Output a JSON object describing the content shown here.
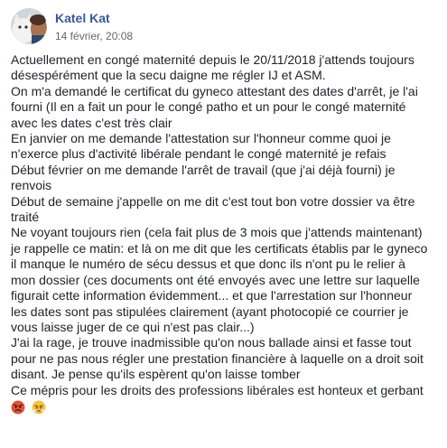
{
  "post": {
    "author": "Katel Kat",
    "timestamp": "14 février, 20:08",
    "lines": [
      "Actuellement en congé maternité depuis le 20/11/2018 j'attends toujours",
      "désespérément que la secu daigne me régler IJ et ASM.",
      "On m'a demandé le certificat du gyneco attestant des dates d'arrêt, je l'ai",
      "fourni (Il en a fait un pour le congé patho et un pour le congé maternité",
      "avec les dates c'est très clair",
      "En janvier on me demande l'attestation sur l'honneur comme quoi je",
      "n'exerce plus d'activité libérale pendant le congé maternité je refais",
      "Début février on me demande l'arrêt de travail (que j'ai déjà fourni) je",
      "renvois",
      "Début de semaine j'appelle on me dit c'est tout bon votre dossier va être",
      "traité",
      "Ne voyant toujours rien (cela fait plus de 3 mois que j'attends maintenant)",
      "je rappelle ce matin: et là on me dit que les certificats établis par le gyneco",
      "il manque le numéro de sécu dessus et que donc ils n'ont pu le relier à",
      "mon dossier (ces documents ont été envoyés avec une lettre sur laquelle",
      "figurait cette information évidemment... et que l'arrestation sur l'honneur",
      "les dates sont pas stipulées clairement (ayant photocopié ce courrier je",
      "vous laisse juger de ce qui n'est pas clair...)",
      "J'ai la rage, je trouve inadmissible qu'on nous ballade ainsi et fasse tout",
      "pour ne pas nous régler une prestation financière à laquelle on a droit soit",
      "disant. Je pense qu'ils espèrent qu'on laisse tomber",
      "Ce mépris pour les droits des professions libérales est honteux et gerbant"
    ],
    "emojis": [
      "angry-face-emoji",
      "face-with-steam-emoji"
    ]
  },
  "colors": {
    "author": "#385898",
    "timestamp": "#616770",
    "text": "#1d2129",
    "angry": "#e0533c",
    "steam": "#f7c244"
  }
}
